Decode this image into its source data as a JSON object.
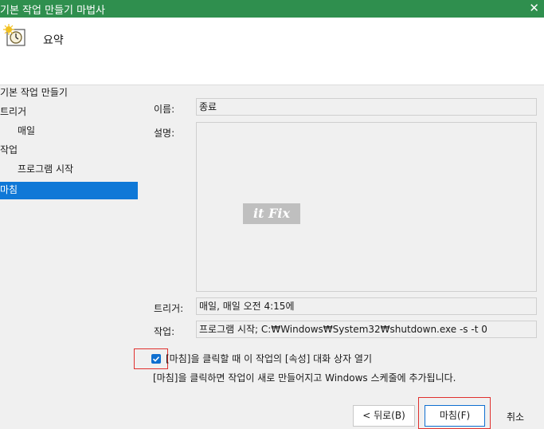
{
  "window": {
    "title": "기본 작업 만들기 마법사"
  },
  "header": {
    "title": "요약",
    "icon": "task-scheduler-clock-icon"
  },
  "sidebar": {
    "items": [
      {
        "label": "기본 작업 만들기"
      },
      {
        "label": "트리거"
      },
      {
        "label": "매일"
      },
      {
        "label": "작업"
      },
      {
        "label": "프로그램 시작"
      },
      {
        "label": "마침"
      }
    ],
    "active_index": 5
  },
  "fields": {
    "name": {
      "label": "이름:",
      "value": "종료"
    },
    "description": {
      "label": "설명:",
      "value": ""
    },
    "trigger": {
      "label": "트리거:",
      "value": "매일, 매일 오전 4:15에"
    },
    "action": {
      "label": "작업:",
      "value": "프로그램 시작; C:₩Windows₩System32₩shutdown.exe -s -t 0"
    }
  },
  "watermark": {
    "text": "it Fix"
  },
  "open_properties": {
    "label": "[마침]을 클릭할 때 이 작업의 [속성] 대화 상자 열기",
    "checked": true
  },
  "info_text": "[마침]을 클릭하면 작업이 새로 만들어지고 Windows 스케줄에 추가됩니다.",
  "buttons": {
    "back": "< 뒤로(B)",
    "finish": "마침(F)",
    "cancel": "취소"
  },
  "colors": {
    "titlebar": "#2f8f4e",
    "selection": "#0f78d7",
    "highlight_box": "#e0302e"
  }
}
